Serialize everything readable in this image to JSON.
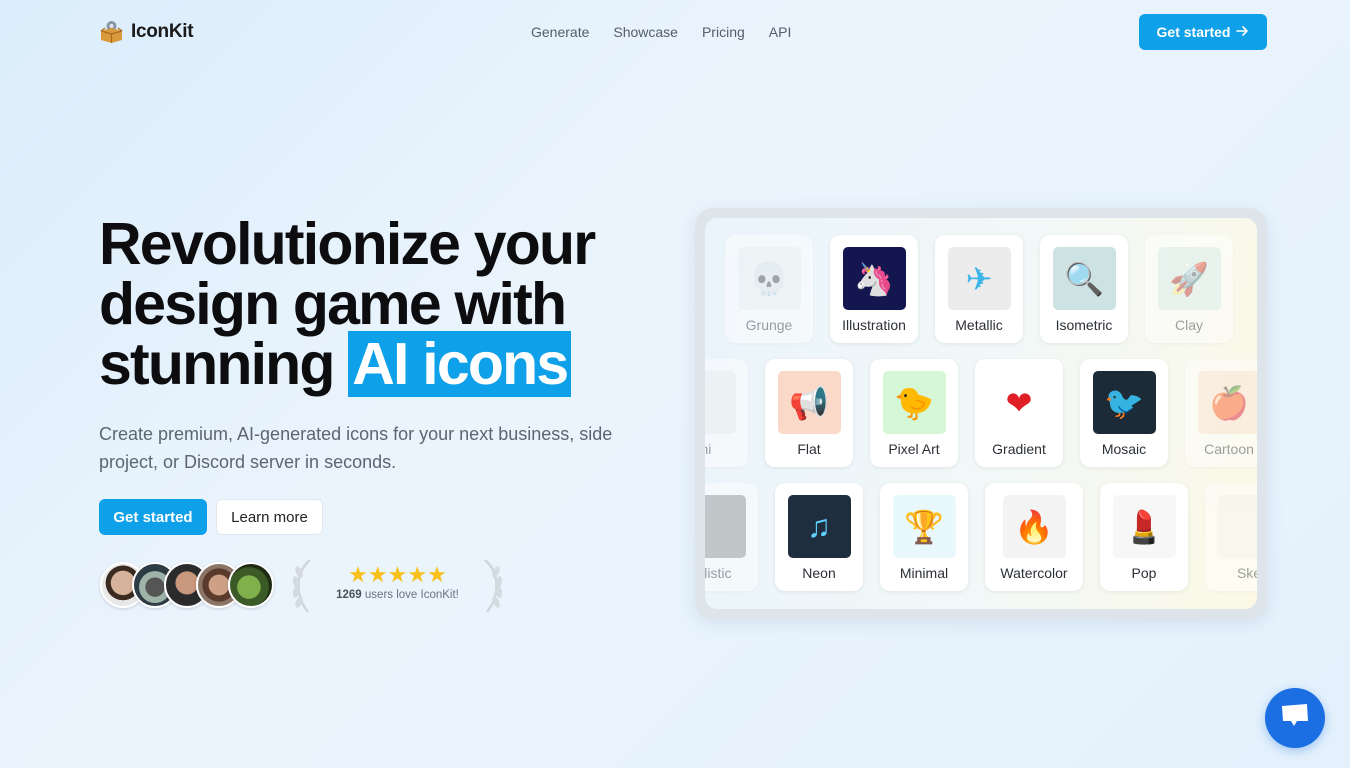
{
  "brand": {
    "name": "IconKit",
    "logo_icon": "box-with-gear-icon"
  },
  "nav": {
    "links": [
      "Generate",
      "Showcase",
      "Pricing",
      "API"
    ],
    "cta_label": "Get started",
    "cta_icon": "arrow-right-icon"
  },
  "hero": {
    "title_line1": "Revolutionize your",
    "title_line2": "design game with",
    "title_line3_plain": "stunning",
    "title_highlight": "AI icons",
    "subtitle": "Create premium, AI-generated icons for your next business, side project, or Discord server in seconds.",
    "primary_cta": "Get started",
    "secondary_cta": "Learn more"
  },
  "social_proof": {
    "avatars": [
      "user-avatar-1",
      "user-avatar-2",
      "user-avatar-3",
      "user-avatar-4",
      "user-avatar-5"
    ],
    "stars": 5,
    "stars_max": 5,
    "count": "1269",
    "text": "users love IconKit!"
  },
  "showcase": {
    "rows": [
      [
        {
          "label": "Grunge",
          "icon": "skull-icon",
          "glyph": "💀",
          "bg": "#f1f1f1",
          "faded": true
        },
        {
          "label": "Illustration",
          "icon": "unicorn-icon",
          "glyph": "🦄",
          "bg": "#13164f"
        },
        {
          "label": "Metallic",
          "icon": "paper-plane-icon",
          "glyph": "✈",
          "bg": "#ececec"
        },
        {
          "label": "Isometric",
          "icon": "magnifier-icon",
          "glyph": "🔍",
          "bg": "#cde3e3"
        },
        {
          "label": "Clay",
          "icon": "rocket-icon",
          "glyph": "🚀",
          "bg": "#d6ecec",
          "faded": true
        }
      ],
      [
        {
          "label": "Origami",
          "visible_label": "mi",
          "icon": "origami-icon",
          "glyph": "",
          "bg": "#eee",
          "faded": true
        },
        {
          "label": "Flat",
          "icon": "megaphone-icon",
          "glyph": "📢",
          "bg": "#fbd9c8"
        },
        {
          "label": "Pixel Art",
          "icon": "duck-icon",
          "glyph": "🐤",
          "bg": "#d5f7d6"
        },
        {
          "label": "Gradient",
          "icon": "heart-icon",
          "glyph": "❤",
          "bg": "#ffffff"
        },
        {
          "label": "Mosaic",
          "icon": "bird-mosaic-icon",
          "glyph": "🐦",
          "bg": "#1d2b38"
        },
        {
          "label": "Cartoon",
          "icon": "apple-icon",
          "glyph": "🍎",
          "bg": "#fbe1d1",
          "faded": true
        }
      ],
      [
        {
          "label": "Realistic",
          "visible_label": "alistic",
          "icon": "car-icon",
          "glyph": "",
          "bg": "#8f8f8f",
          "faded": true
        },
        {
          "label": "Neon",
          "icon": "music-note-icon",
          "glyph": "♫",
          "bg": "#1f2e3e"
        },
        {
          "label": "Minimal",
          "icon": "trophy-icon",
          "glyph": "🏆",
          "bg": "#e8f8fc"
        },
        {
          "label": "Watercolor",
          "icon": "flame-icon",
          "glyph": "🔥",
          "bg": "#f3f3f3"
        },
        {
          "label": "Pop",
          "icon": "lipstick-icon",
          "glyph": "💄",
          "bg": "#f7f7f7"
        },
        {
          "label": "Sketch",
          "visible_label": "Ske",
          "icon": "sketch-icon",
          "glyph": "",
          "bg": "#f3f3f3",
          "faded": true
        }
      ]
    ]
  },
  "chat": {
    "icon": "chat-bubble-icon"
  },
  "colors": {
    "accent": "#0ea0e8",
    "chat": "#1c6fe3",
    "star": "#f8c01a"
  }
}
